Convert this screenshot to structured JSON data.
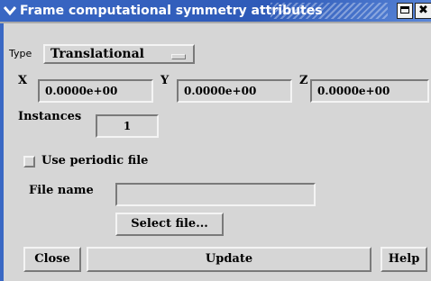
{
  "window": {
    "title": "Frame computational symmetry attributes",
    "menu_glyph": "✔",
    "close_glyph": "✖"
  },
  "type": {
    "label": "Type",
    "selected": "Translational"
  },
  "coords": {
    "x_label": "X",
    "x_value": "0.0000e+00",
    "y_label": "Y",
    "y_value": "0.0000e+00",
    "z_label": "Z",
    "z_value": "0.0000e+00"
  },
  "instances": {
    "label": "Instances",
    "value": "1"
  },
  "periodic": {
    "label": "Use periodic file",
    "checked": false
  },
  "file": {
    "label": "File name",
    "value": "",
    "select_button": "Select file..."
  },
  "actions": {
    "close": "Close",
    "update": "Update",
    "help": "Help"
  },
  "colors": {
    "title_bar": "#3a68c4",
    "panel": "#d6d6d6"
  }
}
